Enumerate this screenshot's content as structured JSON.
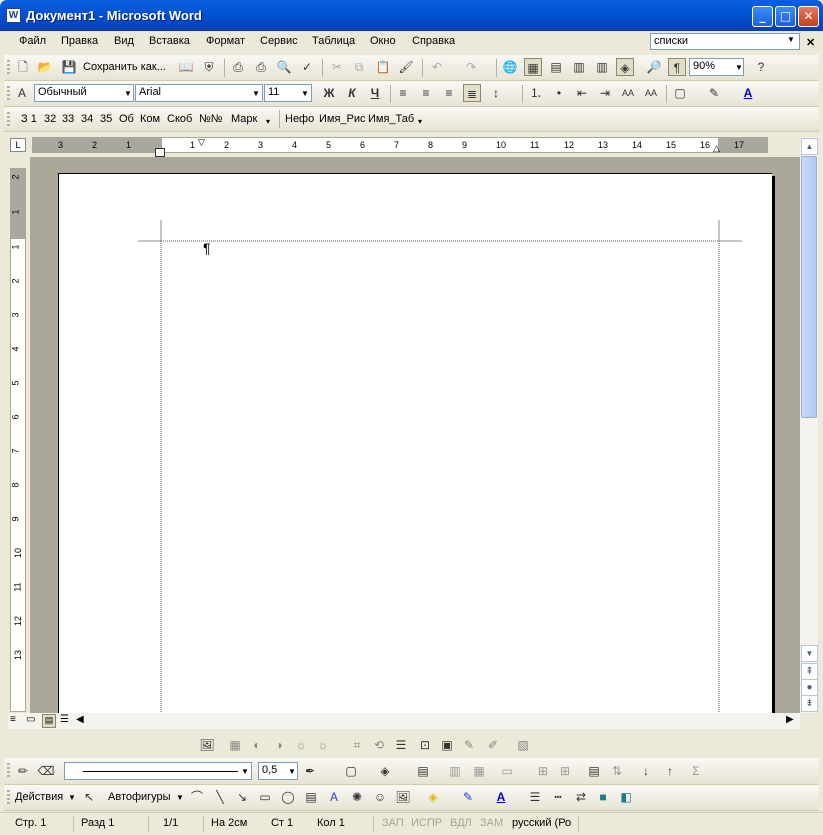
{
  "window": {
    "title": "Документ1 - Microsoft Word",
    "icon": "word-icon"
  },
  "menu": {
    "items": [
      "Файл",
      "Правка",
      "Вид",
      "Вставка",
      "Формат",
      "Сервис",
      "Таблица",
      "Окно",
      "Справка"
    ],
    "help_search": "списки"
  },
  "standard_toolbar": {
    "save_as_label": "Сохранить как...",
    "zoom": "90%"
  },
  "formatting_toolbar": {
    "style": "Обычный",
    "font": "Arial",
    "size": "11",
    "bold": "Ж",
    "italic": "К",
    "underline": "Ч"
  },
  "custom_toolbar": {
    "items": [
      "З 1",
      "32",
      "33",
      "34",
      "35",
      "Об",
      "Ком",
      "Скоб",
      "№№",
      "Марк",
      "Нефо",
      "Имя_Рис",
      "Имя_Таб"
    ]
  },
  "ruler": {
    "h_left": [
      "3",
      "2",
      "1"
    ],
    "h_right": [
      "1",
      "2",
      "3",
      "4",
      "5",
      "6",
      "7",
      "8",
      "9",
      "10",
      "11",
      "12",
      "13",
      "14",
      "15",
      "16",
      "17"
    ],
    "vertical": [
      "2",
      "1",
      "1",
      "2",
      "3",
      "4",
      "5",
      "6",
      "7",
      "8",
      "9",
      "10",
      "11",
      "12",
      "13"
    ]
  },
  "document": {
    "paragraph_mark": "¶"
  },
  "line_weight": "0,5",
  "drawing": {
    "actions": "Действия",
    "autoshapes": "Автофигуры"
  },
  "status": {
    "page": "Стр. 1",
    "section": "Разд 1",
    "pages": "1/1",
    "at": "На 2см",
    "line": "Ст 1",
    "col": "Кол 1",
    "rec": "ЗАП",
    "trk": "ИСПР",
    "ext": "ВДЛ",
    "ovr": "ЗАМ",
    "lang": "русский (Ро"
  }
}
